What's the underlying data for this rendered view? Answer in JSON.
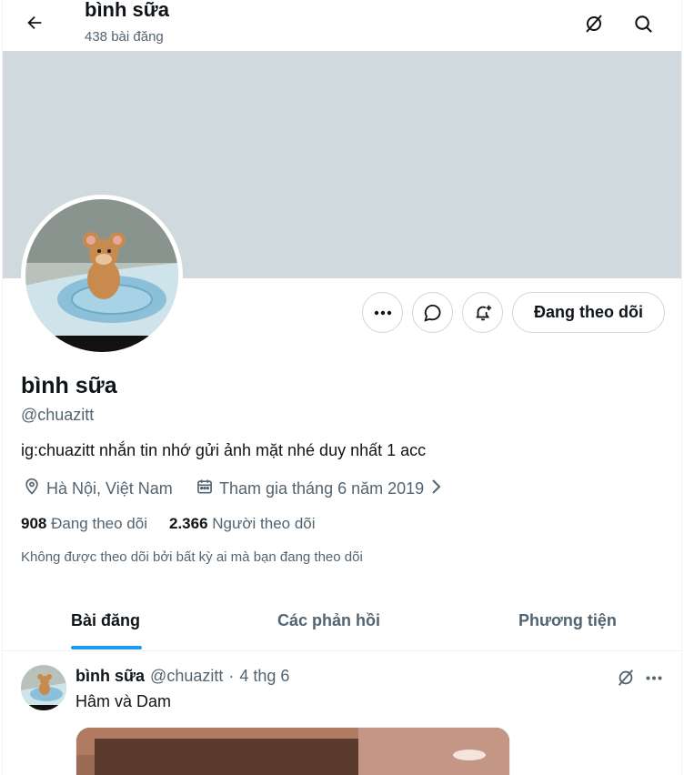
{
  "header": {
    "back_icon": "arrow-left-icon",
    "title": "bình sữa",
    "posts_count": "438 bài đăng",
    "grok_icon": "grok-icon",
    "search_icon": "search-icon"
  },
  "profile": {
    "name": "bình sữa",
    "handle": "@chuazitt",
    "bio": "ig:chuazitt nhắn tin nhớ gửi ảnh mặt nhé duy nhất 1 acc",
    "location": "Hà Nội, Việt Nam",
    "joined": "Tham gia tháng 6 năm 2019",
    "following_count": "908",
    "following_label": "Đang theo dõi",
    "followers_count": "2.366",
    "followers_label": "Người theo dõi",
    "followed_by_note": "Không được theo dõi bởi bất kỳ ai mà bạn đang theo dõi"
  },
  "actions": {
    "more_icon": "more-icon",
    "message_icon": "message-icon",
    "notify_icon": "bell-plus-icon",
    "follow_label": "Đang theo dõi"
  },
  "tabs": [
    {
      "label": "Bài đăng",
      "active": true
    },
    {
      "label": "Các phản hồi",
      "active": false
    },
    {
      "label": "Phương tiện",
      "active": false
    }
  ],
  "tweet": {
    "name": "bình sữa",
    "handle": "@chuazitt",
    "separator": "·",
    "date": "4 thg 6",
    "text": "Hâm và Dam"
  },
  "colors": {
    "accent": "#1d9bf0",
    "banner": "#cfd9de",
    "muted": "#536471",
    "text": "#0f1419"
  }
}
